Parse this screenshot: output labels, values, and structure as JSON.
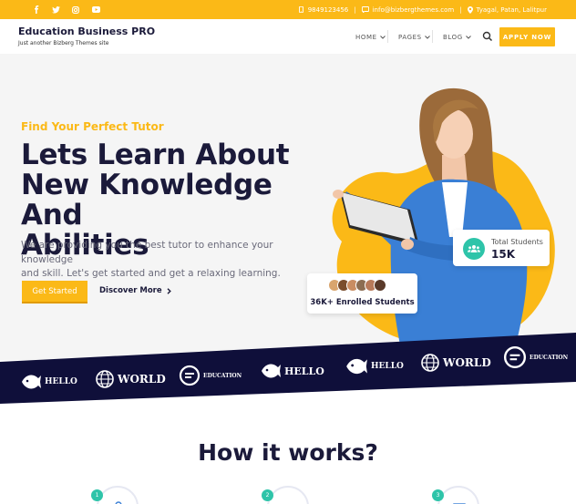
{
  "topbar": {
    "social": [
      "facebook-icon",
      "twitter-icon",
      "instagram-icon",
      "youtube-icon"
    ],
    "phone": "9849123456",
    "email": "info@bizbergthemes.com",
    "location": "Tyagal, Patan, Lalitpur",
    "separator": "|"
  },
  "header": {
    "site_title": "Education Business PRO",
    "tagline": "Just another Bizberg Themes site",
    "nav": [
      {
        "label": "HOME"
      },
      {
        "label": "PAGES"
      },
      {
        "label": "BLOG"
      }
    ],
    "apply_label": "APPLY NOW"
  },
  "hero": {
    "eyebrow": "Find Your Perfect Tutor",
    "headline_1": "Lets Learn About",
    "headline_2": "New Knowledge And",
    "headline_3": "Abilities",
    "subtext_1": "We are providing you the best tutor to enhance your knowledge",
    "subtext_2": "and skill. Let's get started and get a relaxing learning.",
    "cta_primary": "Get Started",
    "cta_secondary": "Discover More",
    "total_students_label": "Total Students",
    "total_students_value": "15K",
    "enrolled_label": "36K+ Enrolled Students"
  },
  "logos": [
    {
      "text": "HELLO",
      "icon": "fish-icon"
    },
    {
      "text": "WORLD",
      "icon": "globe-icon"
    },
    {
      "text": "EDUCATION",
      "icon": "speech-bubble-icon"
    },
    {
      "text": "HELLO",
      "icon": "fish-icon"
    },
    {
      "text": "HELLO",
      "icon": "fish-icon"
    },
    {
      "text": "WORLD",
      "icon": "globe-icon"
    },
    {
      "text": "EDUCATION",
      "icon": "speech-bubble-icon"
    }
  ],
  "how": {
    "title": "How it works?",
    "steps": [
      "1",
      "2",
      "3"
    ]
  },
  "colors": {
    "accent": "#fbb917",
    "navy": "#0f0f3a",
    "teal": "#2ec4a9"
  }
}
